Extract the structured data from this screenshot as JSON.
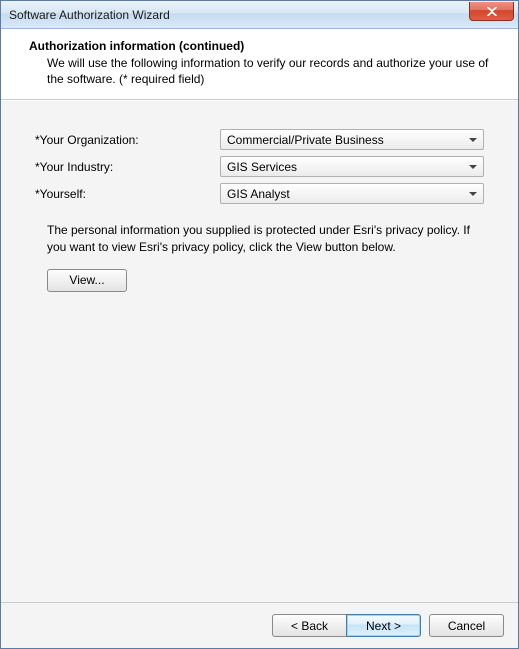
{
  "window": {
    "title": "Software Authorization Wizard"
  },
  "header": {
    "title": "Authorization information (continued)",
    "subtitle": "We will use the following information to verify our records and authorize your use of the software. (* required field)"
  },
  "form": {
    "org_label": "*Your Organization:",
    "org_value": "Commercial/Private Business",
    "industry_label": "*Your Industry:",
    "industry_value": "GIS Services",
    "yourself_label": "*Yourself:",
    "yourself_value": "GIS Analyst"
  },
  "privacy": {
    "text": "The personal information you supplied is protected under Esri's privacy policy. If you want to view Esri's privacy policy, click the View button below.",
    "view_label": "View..."
  },
  "footer": {
    "back_label": "< Back",
    "next_label": "Next >",
    "cancel_label": "Cancel"
  }
}
